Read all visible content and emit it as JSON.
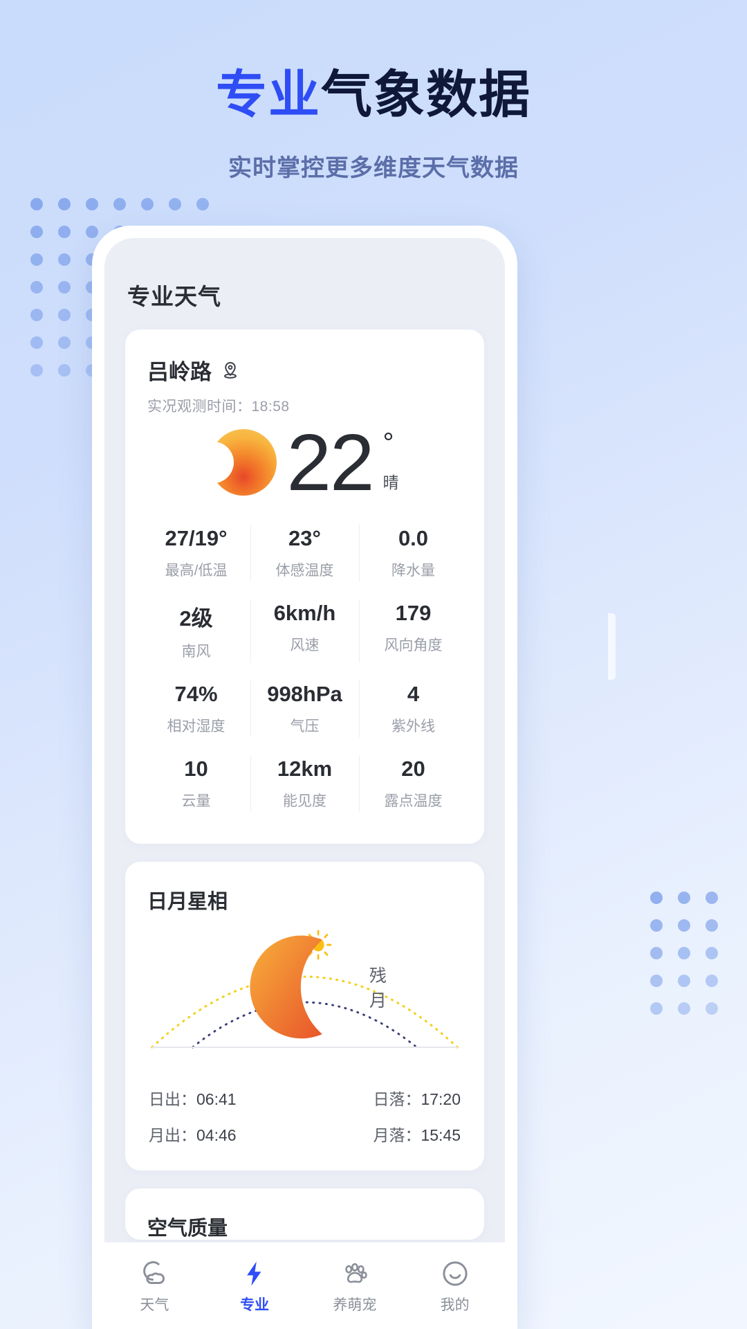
{
  "promo": {
    "headline_accent": "专业",
    "headline_rest": "气象数据",
    "subtitle": "实时掌控更多维度天气数据",
    "accent_color": "#2f4df5",
    "dark_color": "#10183a",
    "subtitle_color": "#5b6ea8",
    "background_color": "#c9dcfb"
  },
  "app": {
    "title": "专业天气"
  },
  "current": {
    "location": "吕岭路",
    "location_icon": "location-pin-icon",
    "observation_label": "实况观测时间：",
    "observation_time": "18:58",
    "weather_icon": "sun-icon",
    "temperature": "22",
    "degree_symbol": "°",
    "condition": "晴"
  },
  "metrics": [
    [
      {
        "value": "27/19°",
        "label": "最高/低温"
      },
      {
        "value": "23°",
        "label": "体感温度"
      },
      {
        "value": "0.0",
        "label": "降水量"
      }
    ],
    [
      {
        "value": "2级",
        "label": "南风"
      },
      {
        "value": "6km/h",
        "label": "风速"
      },
      {
        "value": "179",
        "label": "风向角度"
      }
    ],
    [
      {
        "value": "74%",
        "label": "相对湿度"
      },
      {
        "value": "998hPa",
        "label": "气压"
      },
      {
        "value": "4",
        "label": "紫外线"
      }
    ],
    [
      {
        "value": "10",
        "label": "云量"
      },
      {
        "value": "12km",
        "label": "能见度"
      },
      {
        "value": "20",
        "label": "露点温度"
      }
    ]
  ],
  "astro": {
    "title": "日月星相",
    "sun_icon": "sun-icon",
    "moon_icon": "crescent-moon-icon",
    "moon_phase": "残月",
    "sun_arc_color": "#f5d021",
    "moon_arc_color": "#3b3f7a",
    "rows": [
      {
        "left_label": "日出：",
        "left_value": "06:41",
        "right_label": "日落：",
        "right_value": "17:20"
      },
      {
        "left_label": "月出：",
        "left_value": "04:46",
        "right_label": "月落：",
        "right_value": "15:45"
      }
    ]
  },
  "air_quality": {
    "title": "空气质量"
  },
  "tabbar": {
    "items": [
      {
        "label": "天气",
        "icon": "cloud-moon-icon",
        "active": false
      },
      {
        "label": "专业",
        "icon": "lightning-bolt-icon",
        "active": true
      },
      {
        "label": "养萌宠",
        "icon": "paw-icon",
        "active": false
      },
      {
        "label": "我的",
        "icon": "smiley-face-icon",
        "active": false
      }
    ],
    "active_color": "#2f4df5",
    "inactive_color": "#8b8f99"
  }
}
